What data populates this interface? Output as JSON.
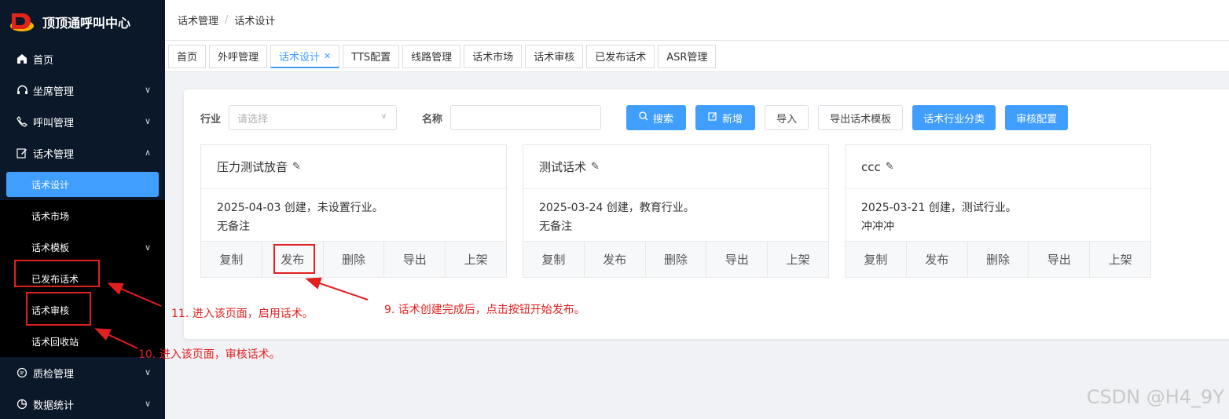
{
  "app": {
    "title": "顶顶通呼叫中心"
  },
  "sidebar": {
    "items": [
      {
        "label": "首页",
        "icon": "home-icon"
      },
      {
        "label": "坐席管理",
        "icon": "headset-icon"
      },
      {
        "label": "呼叫管理",
        "icon": "phone-icon"
      },
      {
        "label": "话术管理",
        "icon": "edit-icon"
      },
      {
        "label": "质检管理",
        "icon": "chat-icon"
      },
      {
        "label": "数据统计",
        "icon": "pie-chart-icon"
      }
    ],
    "sub": [
      "话术设计",
      "话术市场",
      "话术模板",
      "已发布话术",
      "话术审核",
      "话术回收站"
    ]
  },
  "breadcrumb": [
    "话术管理",
    "话术设计"
  ],
  "tabs": [
    "首页",
    "外呼管理",
    "话术设计",
    "TTS配置",
    "线路管理",
    "话术市场",
    "话术审核",
    "已发布话术",
    "ASR管理"
  ],
  "filter": {
    "industry_label": "行业",
    "industry_placeholder": "请选择",
    "name_label": "名称",
    "search": "搜索",
    "add": "新增",
    "import": "导入",
    "export_template": "导出话术模板",
    "industry_category": "话术行业分类",
    "review_config": "审核配置"
  },
  "cards": [
    {
      "title": "压力测试放音",
      "line1": "2025-04-03 创建，未设置行业。",
      "line2": "无备注"
    },
    {
      "title": "测试话术",
      "line1": "2025-03-24 创建，教育行业。",
      "line2": "无备注"
    },
    {
      "title": "ccc",
      "line1": "2025-03-21 创建，测试行业。",
      "line2": "冲冲冲"
    }
  ],
  "card_actions": [
    "复制",
    "发布",
    "删除",
    "导出",
    "上架"
  ],
  "annotations": {
    "n9": "9. 话术创建完成后，点击按钮开始发布。",
    "n10": "10. 进入该页面，审核话术。",
    "n11": "11. 进入该页面，启用话术。"
  },
  "watermark": "CSDN @H4_9Y",
  "colors": {
    "primary": "#409eff",
    "sidebar": "#0b1829",
    "annotation": "#e02020"
  }
}
